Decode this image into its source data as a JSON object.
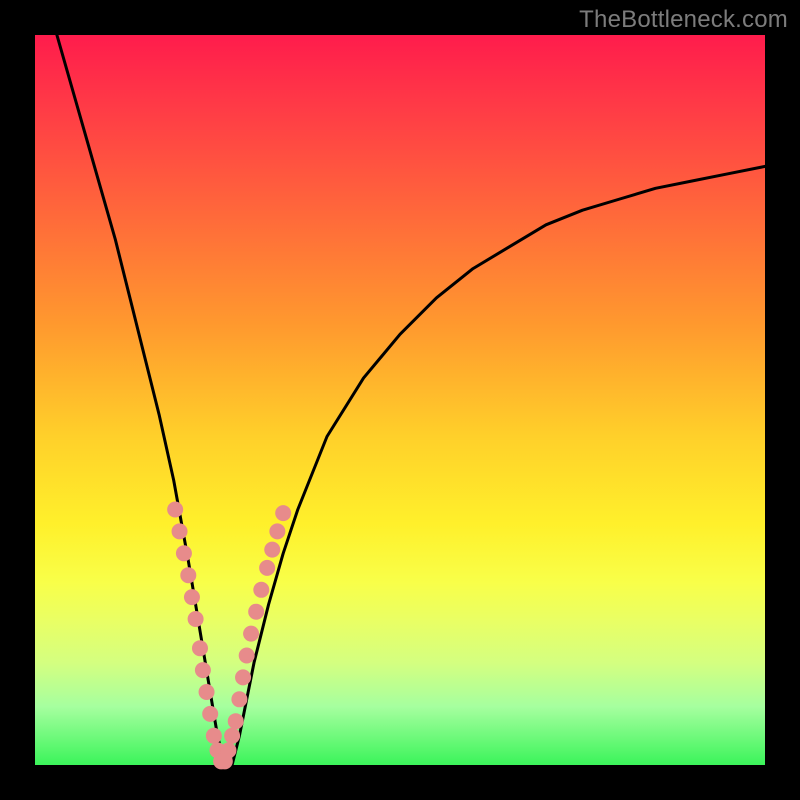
{
  "watermark": "TheBottleneck.com",
  "colors": {
    "curve": "#000000",
    "dot": "#e78b8b",
    "background_top": "#ff1c4c",
    "background_bottom": "#3bf45a"
  },
  "chart_data": {
    "type": "line",
    "title": "",
    "xlabel": "",
    "ylabel": "",
    "xlim": [
      0,
      100
    ],
    "ylim": [
      0,
      100
    ],
    "series": [
      {
        "name": "bottleneck-curve",
        "x": [
          3,
          5,
          7,
          9,
          11,
          13,
          15,
          17,
          19,
          21,
          22,
          23,
          24,
          25,
          26,
          27,
          28,
          29,
          30,
          32,
          34,
          36,
          38,
          40,
          45,
          50,
          55,
          60,
          65,
          70,
          75,
          80,
          85,
          90,
          95,
          100
        ],
        "y": [
          100,
          93,
          86,
          79,
          72,
          64,
          56,
          48,
          39,
          28,
          22,
          16,
          10,
          4,
          0,
          0,
          4,
          9,
          14,
          22,
          29,
          35,
          40,
          45,
          53,
          59,
          64,
          68,
          71,
          74,
          76,
          77.5,
          79,
          80,
          81,
          82
        ]
      }
    ],
    "highlight_points": {
      "name": "pink-dots",
      "x": [
        19.2,
        19.8,
        20.4,
        21.0,
        21.5,
        22.0,
        22.6,
        23.0,
        23.5,
        24.0,
        24.5,
        25.0,
        25.5,
        26.0,
        26.5,
        27.0,
        27.5,
        28.0,
        28.5,
        29.0,
        29.6,
        30.3,
        31.0,
        31.8,
        32.5,
        33.2,
        34.0
      ],
      "y": [
        35,
        32,
        29,
        26,
        23,
        20,
        16,
        13,
        10,
        7,
        4,
        2,
        0.5,
        0.5,
        2,
        4,
        6,
        9,
        12,
        15,
        18,
        21,
        24,
        27,
        29.5,
        32,
        34.5
      ]
    }
  }
}
